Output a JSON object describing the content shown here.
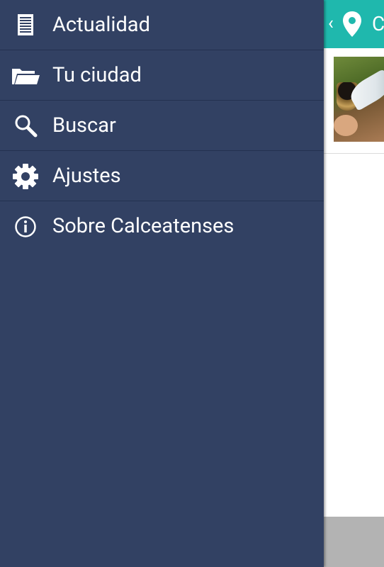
{
  "drawer": {
    "items": [
      {
        "label": "Actualidad",
        "icon": "news-list-icon"
      },
      {
        "label": "Tu ciudad",
        "icon": "folder-icon"
      },
      {
        "label": "Buscar",
        "icon": "search-icon"
      },
      {
        "label": "Ajustes",
        "icon": "gear-icon"
      },
      {
        "label": "Sobre Calceatenses",
        "icon": "info-icon"
      }
    ],
    "background": "#324163"
  },
  "main": {
    "appbar": {
      "title": "C",
      "color": "#1fb8ad"
    }
  }
}
